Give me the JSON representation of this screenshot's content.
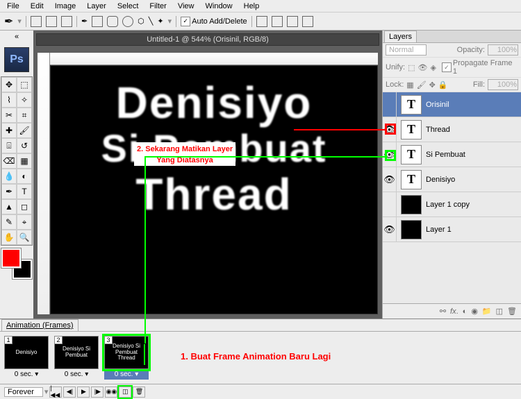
{
  "menubar": [
    "File",
    "Edit",
    "Image",
    "Layer",
    "Select",
    "Filter",
    "View",
    "Window",
    "Help"
  ],
  "options": {
    "auto_add_delete": "Auto Add/Delete"
  },
  "app_badge": "Ps",
  "document": {
    "title": "Untitled-1 @ 544% (Orisinil, RGB/8)"
  },
  "canvas_text": {
    "l1": "Denisiyo",
    "l2": "Si Pembuat",
    "l3": "Thread"
  },
  "annotations": {
    "step2_line1": "2. Sekarang Matikan Layer",
    "step2_line2": "Yang Diatasnya",
    "step1": "1. Buat Frame Animation Baru Lagi"
  },
  "layers_panel": {
    "tab": "Layers",
    "blend": "Normal",
    "opacity_label": "Opacity:",
    "opacity_val": "100%",
    "unify_label": "Unify:",
    "propagate": "Propagate Frame 1",
    "lock_label": "Lock:",
    "fill_label": "Fill:",
    "fill_val": "100%",
    "layers": [
      {
        "eye": "",
        "thumb": "T",
        "name": "Orisinil",
        "sel": true
      },
      {
        "eye": "👁",
        "thumb": "T",
        "name": "Thread"
      },
      {
        "eye": "👁",
        "thumb": "T",
        "name": "Si Pembuat"
      },
      {
        "eye": "👁",
        "thumb": "T",
        "name": "Denisiyo"
      },
      {
        "eye": "",
        "thumb": "",
        "name": "Layer 1 copy",
        "black": true
      },
      {
        "eye": "👁",
        "thumb": "",
        "name": "Layer 1",
        "black": true
      }
    ]
  },
  "animation": {
    "tab": "Animation (Frames)",
    "frames": [
      {
        "num": "1",
        "text": "Denisiyo",
        "time": "0 sec."
      },
      {
        "num": "2",
        "text": "Denisiyo\nSi Pembuat",
        "time": "0 sec."
      },
      {
        "num": "3",
        "text": "Denisiyo\nSi Pembuat\nThread",
        "time": "0 sec.",
        "sel": true
      }
    ],
    "loop": "Forever"
  }
}
